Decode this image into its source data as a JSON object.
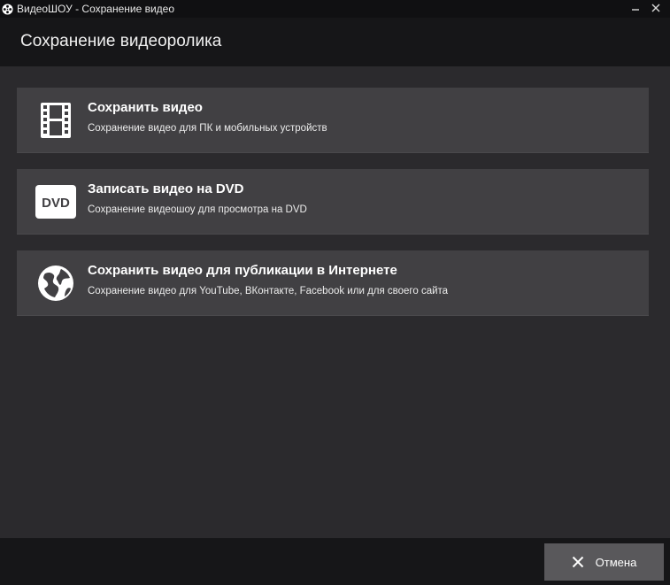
{
  "window": {
    "title": "ВидеоШОУ - Сохранение видео",
    "app_icon": "film-reel-icon",
    "close_icon": "close-icon"
  },
  "header": {
    "title": "Сохранение видеоролика"
  },
  "options": [
    {
      "icon": "film-strip-icon",
      "title": "Сохранить видео",
      "subtitle": "Сохранение видео для ПК и мобильных устройств"
    },
    {
      "icon": "dvd-icon",
      "icon_text": "DVD",
      "title": "Записать видео на DVD",
      "subtitle": "Сохранение видеошоу для просмотра на DVD"
    },
    {
      "icon": "globe-icon",
      "title": "Сохранить видео для публикации в Интернете",
      "subtitle": "Сохранение видео для YouTube, ВКонтакте, Facebook или для своего сайта"
    }
  ],
  "footer": {
    "cancel_label": "Отмена",
    "cancel_icon": "close-icon"
  },
  "colors": {
    "background": "#2b2a2d",
    "titlebar": "#101012",
    "header": "#161618",
    "option_bg": "#414043",
    "button_bg": "#59585b",
    "text": "#ffffff"
  }
}
